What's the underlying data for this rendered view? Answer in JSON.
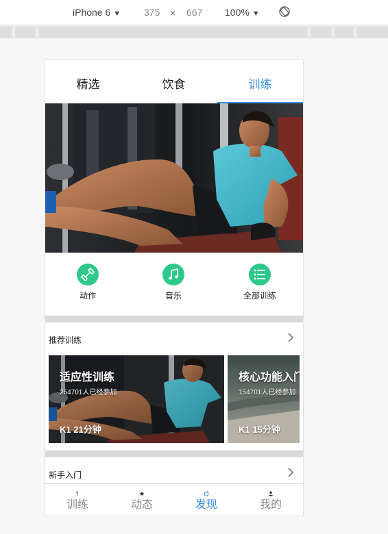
{
  "devtools": {
    "device": "iPhone 6",
    "width": "375",
    "times": "×",
    "height": "667",
    "zoom": "100%",
    "dropdown_caret": "▼",
    "rotate_icon": "rotate-icon"
  },
  "app": {
    "tabs": [
      {
        "label": "精选",
        "active": false
      },
      {
        "label": "饮食",
        "active": false
      },
      {
        "label": "训练",
        "active": true
      }
    ],
    "shortcuts": [
      {
        "label": "动作",
        "icon": "dumbbell-icon"
      },
      {
        "label": "音乐",
        "icon": "music-note-icon"
      },
      {
        "label": "全部训练",
        "icon": "list-icon"
      }
    ],
    "recommended": {
      "title": "推荐训练",
      "cards": [
        {
          "title": "适应性训练",
          "participants": "254701人已经参加",
          "meta": "K1 21分钟"
        },
        {
          "title": "核心功能入门",
          "participants": "154701人已经参加",
          "meta": "K1 15分钟"
        }
      ]
    },
    "beginner": {
      "title": "新手入门"
    },
    "bottom_nav": [
      {
        "label": "训练",
        "active": false
      },
      {
        "label": "动态",
        "active": false
      },
      {
        "label": "发现",
        "active": true
      },
      {
        "label": "我的",
        "active": false
      }
    ]
  },
  "colors": {
    "accent": "#3a8ee6",
    "icon_green": "#2ec98a",
    "divider": "#d9dbd9"
  }
}
